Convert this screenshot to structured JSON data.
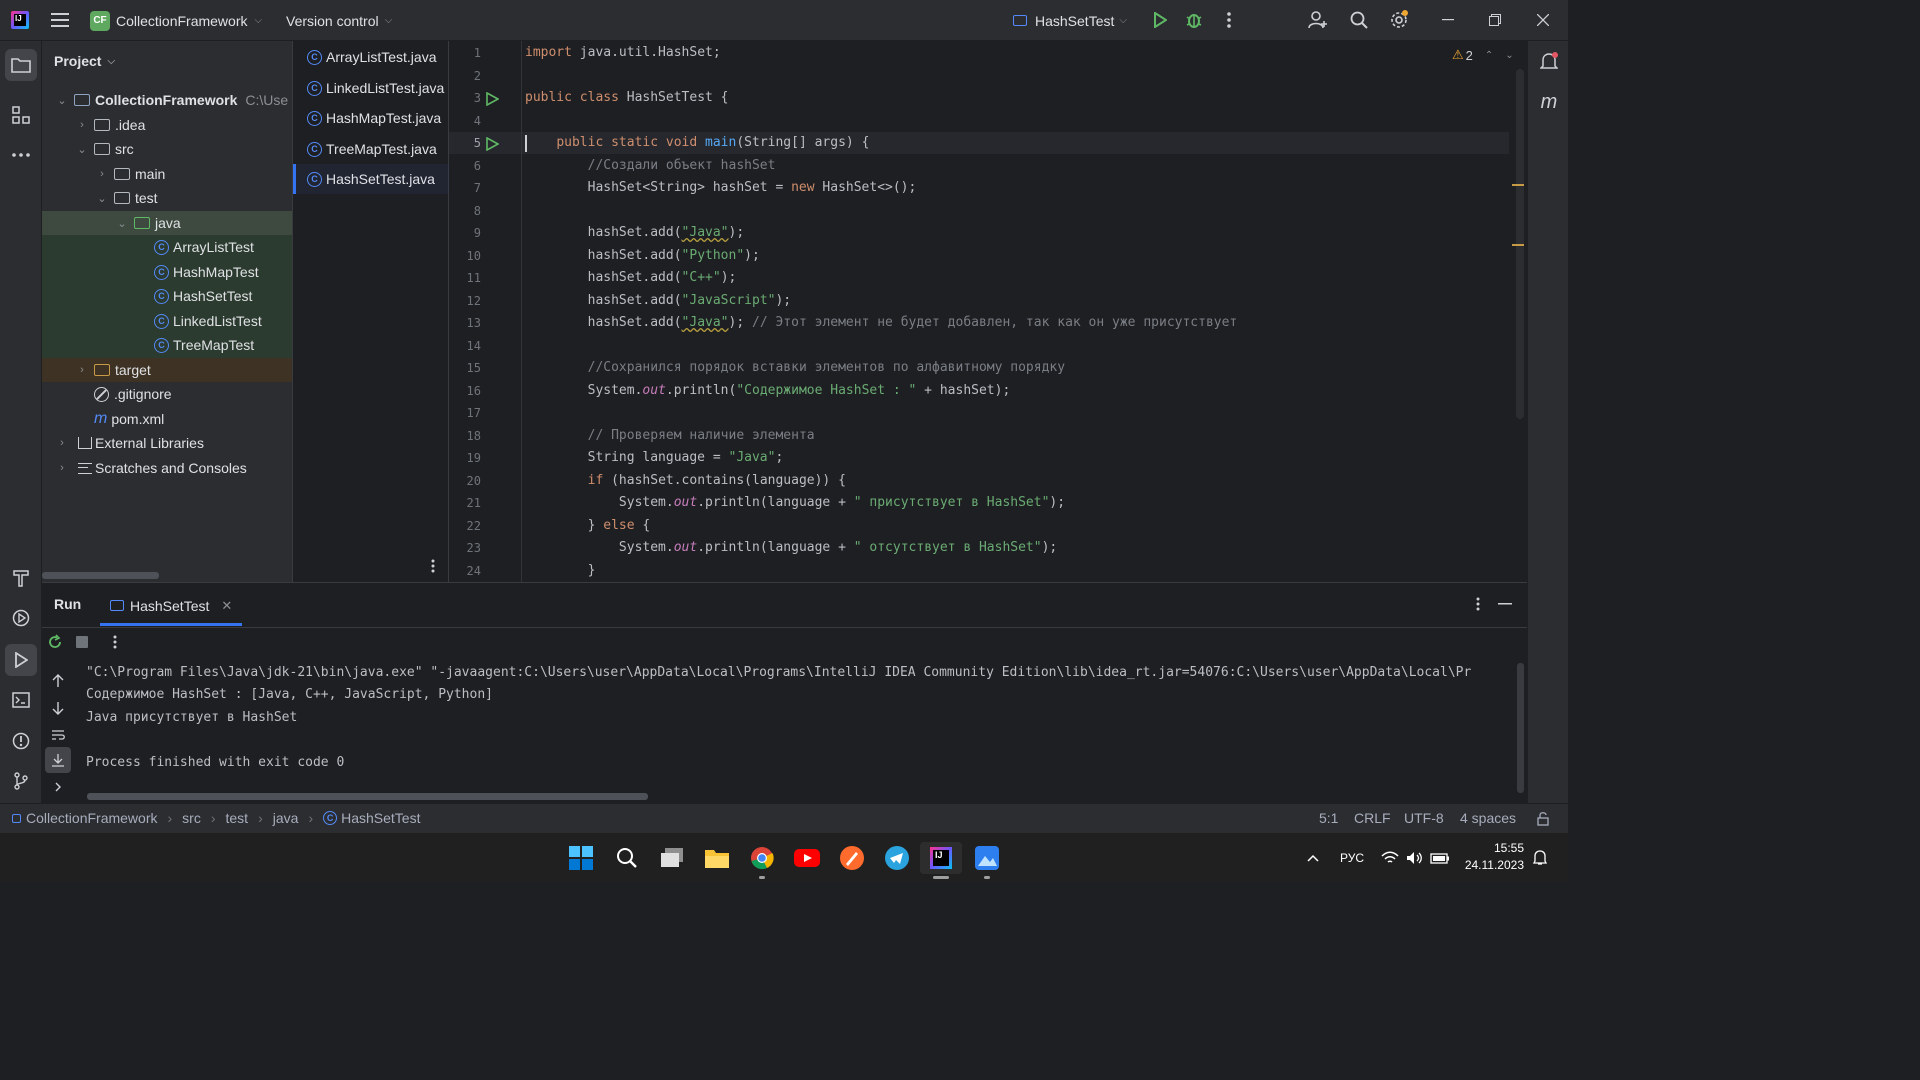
{
  "titlebar": {
    "project_badge": "CF",
    "project_name": "CollectionFramework",
    "vcs_menu": "Version control",
    "run_config": "HashSetTest"
  },
  "project_panel": {
    "title": "Project",
    "root_name": "CollectionFramework",
    "root_path": "C:\\Use",
    "items": {
      "idea": ".idea",
      "src": "src",
      "main": "main",
      "test": "test",
      "java": "java",
      "c1": "ArrayListTest",
      "c2": "HashMapTest",
      "c3": "HashSetTest",
      "c4": "LinkedListTest",
      "c5": "TreeMapTest",
      "target": "target",
      "gitignore": ".gitignore",
      "pom": "pom.xml",
      "libs": "External Libraries",
      "scratches": "Scratches and Consoles"
    }
  },
  "editor_tabs": [
    "ArrayListTest.java",
    "LinkedListTest.java",
    "HashMapTest.java",
    "TreeMapTest.java",
    "HashSetTest.java"
  ],
  "editor": {
    "warnings_count": "2",
    "line_numbers": [
      "1",
      "2",
      "3",
      "4",
      "5",
      "6",
      "7",
      "8",
      "9",
      "10",
      "11",
      "12",
      "13",
      "14",
      "15",
      "16",
      "17",
      "18",
      "19",
      "20",
      "21",
      "22",
      "23",
      "24"
    ]
  },
  "run_panel": {
    "run_tab": "Run",
    "config_tab": "HashSetTest",
    "console_lines": [
      "\"C:\\Program Files\\Java\\jdk-21\\bin\\java.exe\" \"-javaagent:C:\\Users\\user\\AppData\\Local\\Programs\\IntelliJ IDEA Community Edition\\lib\\idea_rt.jar=54076:C:\\Users\\user\\AppData\\Local\\Pr",
      "Содержимое HashSet : [Java, C++, JavaScript, Python]",
      "Java присутствует в HashSet",
      "",
      "Process finished with exit code 0"
    ]
  },
  "statusbar": {
    "crumbs": [
      "CollectionFramework",
      "src",
      "test",
      "java",
      "HashSetTest"
    ],
    "position": "5:1",
    "line_sep": "CRLF",
    "encoding": "UTF-8",
    "indent": "4 spaces"
  },
  "taskbar": {
    "lang": "РУС",
    "time": "15:55",
    "date": "24.11.2023"
  },
  "icons": [
    "intellij-logo-icon",
    "hamburger-menu-icon",
    "run-icon",
    "debug-icon",
    "more-icon",
    "add-user-icon",
    "search-icon",
    "settings-icon",
    "minimize-icon",
    "maximize-icon",
    "close-icon",
    "folder-icon",
    "structure-icon",
    "notifications-icon",
    "rerun-icon",
    "stop-icon",
    "windows-start-icon",
    "taskbar-search-icon"
  ],
  "colors": {
    "accent": "#3574f0",
    "run_green": "#5fb865",
    "string": "#6aab73",
    "keyword": "#cf8e6d"
  }
}
